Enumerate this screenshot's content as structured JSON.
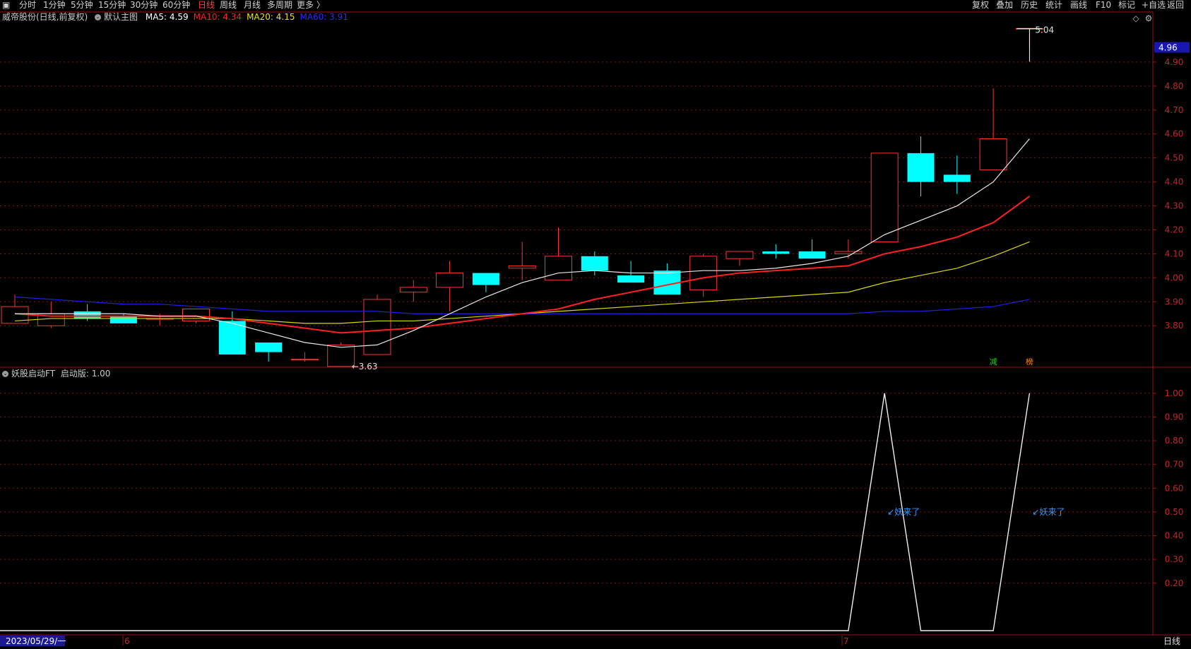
{
  "toolbar": {
    "left": [
      {
        "label": "分时",
        "active": false
      },
      {
        "label": "1分钟",
        "active": false
      },
      {
        "label": "5分钟",
        "active": false
      },
      {
        "label": "15分钟",
        "active": false
      },
      {
        "label": "30分钟",
        "active": false
      },
      {
        "label": "60分钟",
        "active": false
      },
      {
        "label": "日线",
        "active": true
      },
      {
        "label": "周线",
        "active": false
      },
      {
        "label": "月线",
        "active": false
      },
      {
        "label": "多周期",
        "active": false
      },
      {
        "label": "更多 〉",
        "active": false
      }
    ],
    "right": [
      "复权",
      "叠加",
      "历史",
      "统计",
      "画线",
      "F10",
      "标记",
      "+自选",
      "返回"
    ]
  },
  "main_info": {
    "stock": "威帝股份(日线,前复权)",
    "template": "默认主图",
    "ma": [
      {
        "label": "MA5: 4.59",
        "color": "#ffffff"
      },
      {
        "label": "MA10: 4.34",
        "color": "#ff2020"
      },
      {
        "label": "MA20: 4.15",
        "color": "#e6e600"
      },
      {
        "label": "MA60: 3.91",
        "color": "#2a2aff"
      }
    ]
  },
  "sub_info": {
    "label": "妖股启动FT",
    "value_text": "启动版: 1.00"
  },
  "colors": {
    "up": "#ff3232",
    "down": "#00ffff",
    "ma5": "#e8e8e8",
    "ma10": "#ff2020",
    "ma20": "#d8d800",
    "ma60": "#1e1ee6",
    "grid": "#8a1010",
    "axis": "#9a1010",
    "price_tag_bg": "#1818b0"
  },
  "main_axis": {
    "ymin": 3.73,
    "ymax": 5.1,
    "ticks": [
      "4.90",
      "4.80",
      "4.70",
      "4.60",
      "4.50",
      "4.40",
      "4.30",
      "4.20",
      "4.10",
      "4.00",
      "3.90",
      "3.80"
    ],
    "last_price": "4.96"
  },
  "sub_axis": {
    "ymin": 0,
    "ymax": 1.05,
    "ticks": [
      "1.00",
      "0.90",
      "0.80",
      "0.70",
      "0.60",
      "0.50",
      "0.40",
      "0.30",
      "0.20"
    ]
  },
  "chart_data": {
    "type": "candlestick",
    "candles": [
      {
        "o": 3.81,
        "h": 3.93,
        "c": 3.88,
        "l": 3.81
      },
      {
        "o": 3.8,
        "h": 3.9,
        "c": 3.85,
        "l": 3.79
      },
      {
        "o": 3.86,
        "h": 3.89,
        "c": 3.83,
        "l": 3.82
      },
      {
        "o": 3.84,
        "h": 3.85,
        "c": 3.81,
        "l": 3.81
      },
      {
        "o": 3.83,
        "h": 3.85,
        "c": 3.83,
        "l": 3.8
      },
      {
        "o": 3.82,
        "h": 3.87,
        "c": 3.87,
        "l": 3.81
      },
      {
        "o": 3.82,
        "h": 3.86,
        "c": 3.68,
        "l": 3.68
      },
      {
        "o": 3.73,
        "h": 3.73,
        "c": 3.69,
        "l": 3.65
      },
      {
        "o": 3.66,
        "h": 3.69,
        "c": 3.66,
        "l": 3.65
      },
      {
        "o": 3.63,
        "h": 3.73,
        "c": 3.72,
        "l": 3.63
      },
      {
        "o": 3.68,
        "h": 3.93,
        "c": 3.91,
        "l": 3.68
      },
      {
        "o": 3.94,
        "h": 3.99,
        "c": 3.96,
        "l": 3.9
      },
      {
        "o": 3.96,
        "h": 4.07,
        "c": 4.02,
        "l": 3.86
      },
      {
        "o": 4.02,
        "h": 4.02,
        "c": 3.97,
        "l": 3.94
      },
      {
        "o": 4.04,
        "h": 4.15,
        "c": 4.05,
        "l": 3.99
      },
      {
        "o": 3.99,
        "h": 4.21,
        "c": 4.09,
        "l": 3.99
      },
      {
        "o": 4.09,
        "h": 4.11,
        "c": 4.03,
        "l": 4.01
      },
      {
        "o": 4.01,
        "h": 4.07,
        "c": 3.98,
        "l": 3.98
      },
      {
        "o": 4.03,
        "h": 4.06,
        "c": 3.93,
        "l": 3.93
      },
      {
        "o": 3.95,
        "h": 4.1,
        "c": 4.09,
        "l": 3.92
      },
      {
        "o": 4.08,
        "h": 4.11,
        "c": 4.11,
        "l": 4.05
      },
      {
        "o": 4.11,
        "h": 4.14,
        "c": 4.1,
        "l": 4.08
      },
      {
        "o": 4.11,
        "h": 4.16,
        "c": 4.08,
        "l": 4.08
      },
      {
        "o": 4.1,
        "h": 4.16,
        "c": 4.11,
        "l": 4.08
      },
      {
        "o": 4.15,
        "h": 4.52,
        "c": 4.52,
        "l": 4.15
      },
      {
        "o": 4.52,
        "h": 4.59,
        "c": 4.4,
        "l": 4.34
      },
      {
        "o": 4.43,
        "h": 4.51,
        "c": 4.4,
        "l": 4.35
      },
      {
        "o": 4.45,
        "h": 4.79,
        "c": 4.58,
        "l": 4.45
      },
      {
        "o": 5.04,
        "h": 5.04,
        "c": 5.04,
        "l": 4.96
      }
    ],
    "ma5": [
      3.85,
      3.85,
      3.85,
      3.85,
      3.84,
      3.84,
      3.81,
      3.77,
      3.73,
      3.71,
      3.72,
      3.78,
      3.85,
      3.92,
      3.98,
      4.02,
      4.03,
      4.02,
      4.02,
      4.03,
      4.03,
      4.04,
      4.06,
      4.09,
      4.18,
      4.24,
      4.3,
      4.4,
      4.58
    ],
    "ma10": [
      3.85,
      3.84,
      3.84,
      3.84,
      3.84,
      3.84,
      3.83,
      3.81,
      3.79,
      3.77,
      3.78,
      3.79,
      3.81,
      3.83,
      3.85,
      3.87,
      3.91,
      3.94,
      3.97,
      4.0,
      4.02,
      4.03,
      4.04,
      4.05,
      4.1,
      4.13,
      4.17,
      4.23,
      4.34
    ],
    "ma20": [
      3.82,
      3.83,
      3.83,
      3.83,
      3.83,
      3.83,
      3.83,
      3.82,
      3.81,
      3.81,
      3.82,
      3.82,
      3.83,
      3.84,
      3.85,
      3.86,
      3.87,
      3.88,
      3.89,
      3.9,
      3.91,
      3.92,
      3.93,
      3.94,
      3.98,
      4.01,
      4.04,
      4.09,
      4.15
    ],
    "ma60": [
      3.92,
      3.91,
      3.9,
      3.89,
      3.89,
      3.88,
      3.87,
      3.86,
      3.86,
      3.86,
      3.86,
      3.85,
      3.85,
      3.85,
      3.85,
      3.85,
      3.85,
      3.85,
      3.85,
      3.85,
      3.85,
      3.85,
      3.85,
      3.85,
      3.86,
      3.86,
      3.87,
      3.88,
      3.91
    ],
    "indicator": [
      0,
      0,
      0,
      0,
      0,
      0,
      0,
      0,
      0,
      0,
      0,
      0,
      0,
      0,
      0,
      0,
      0,
      0,
      0,
      0,
      0,
      0,
      0,
      0,
      1,
      0,
      0,
      0,
      1
    ],
    "low_label": "3.63",
    "high_label": "5.04",
    "signal_text": "妖来了",
    "markers": [
      {
        "text": "减",
        "index": 27,
        "color": "#22cc22"
      },
      {
        "text": "榜",
        "index": 28,
        "color": "#ff8800"
      }
    ]
  },
  "bottom": {
    "date": "2023/05/29/一",
    "month_marks": [
      "6",
      "7"
    ],
    "period": "日线"
  }
}
